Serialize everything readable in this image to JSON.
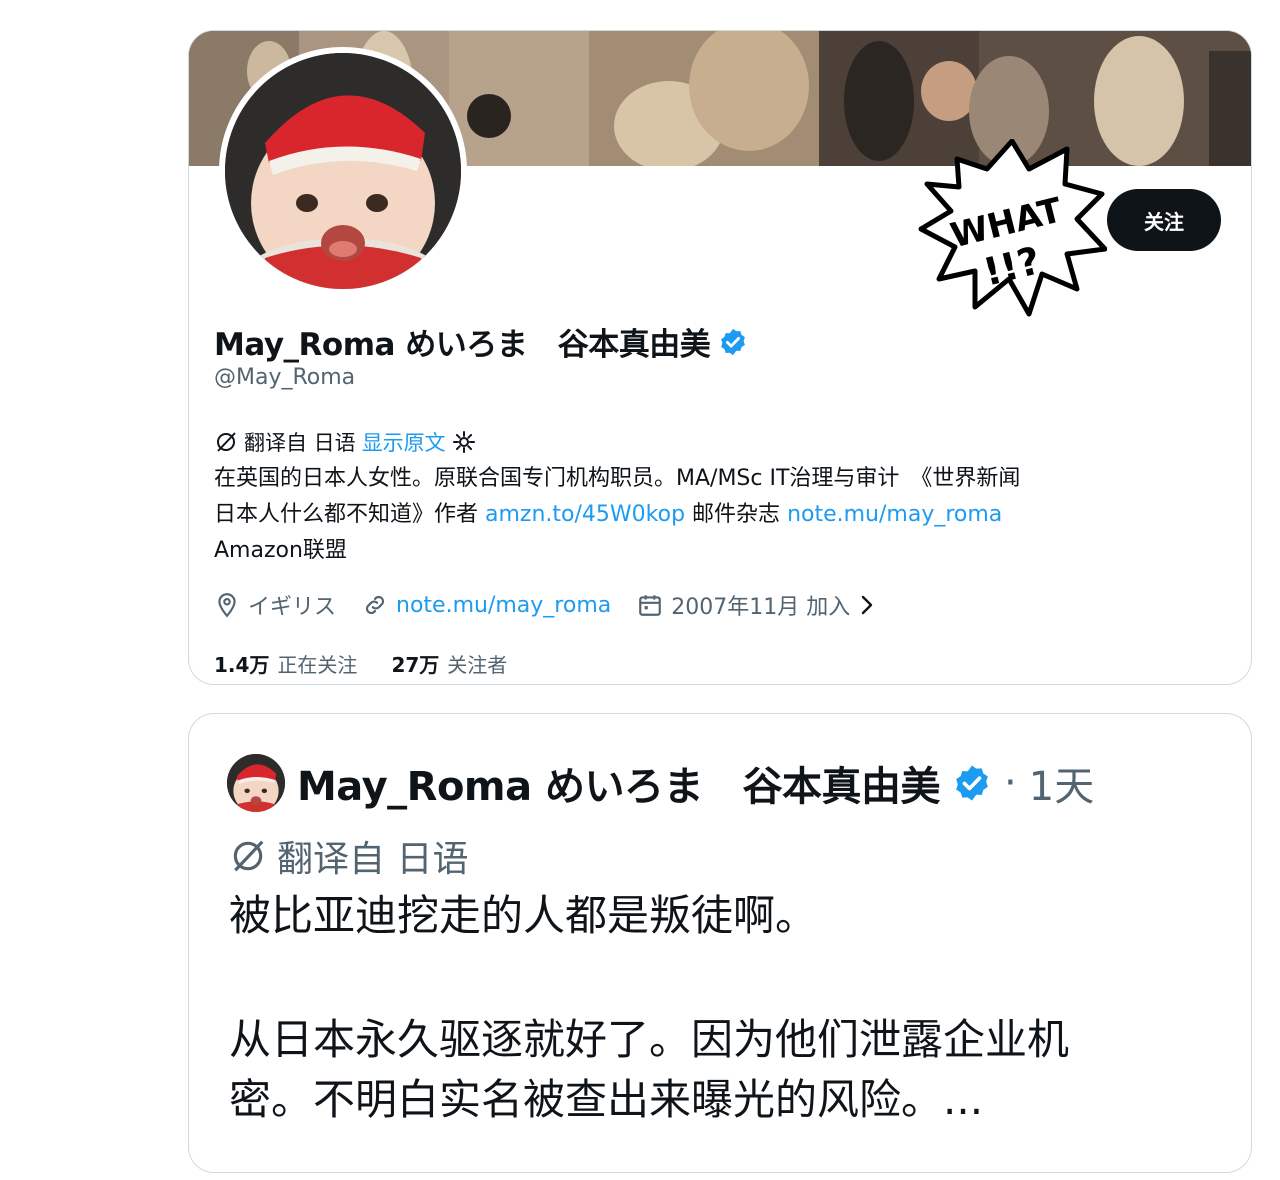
{
  "profile": {
    "follow_label": "关注",
    "display_name": "May_Roma めいろま　谷本真由美",
    "handle": "@May_Roma",
    "translation": {
      "label": "翻译自 日语",
      "show_original": "显示原文"
    },
    "bio": {
      "line1": "在英国的日本人女性。原联合国专门机构职员。MA/MSc IT治理与审计　《世界新闻",
      "line2_a": "日本人什么都不知道》作者",
      "link1": "amzn.to/45W0kop",
      "line2_b": "邮件杂志",
      "link2": "note.mu/may_roma",
      "line3": "Amazon联盟"
    },
    "location": "イギリス",
    "website": "note.mu/may_roma",
    "joined": "2007年11月 加入",
    "stats": {
      "following_count": "1.4万",
      "following_label": "正在关注",
      "followers_count": "27万",
      "followers_label": "关注者"
    },
    "sticker_text": {
      "line1": "WHAT",
      "line2": "!!?"
    }
  },
  "tweet": {
    "author": "May_Roma めいろま　谷本真由美",
    "separator": "·",
    "time": "1天",
    "translation_label": "翻译自 日语",
    "paragraph1": "被比亚迪挖走的人都是叛徒啊。",
    "paragraph2_line1": "从日本永久驱逐就好了。因为他们泄露企业机",
    "paragraph2_line2": "密。不明白实名被查出来曝光的风险。..."
  },
  "colors": {
    "accent": "#1d9bf0",
    "text": "#0f1419",
    "secondary": "#536471",
    "border": "#cfd9de",
    "follow_bg": "#0f1419"
  },
  "icons": [
    "verified-icon",
    "translate-icon",
    "gear-icon",
    "location-pin-icon",
    "link-icon",
    "calendar-icon",
    "chevron-right-icon"
  ]
}
